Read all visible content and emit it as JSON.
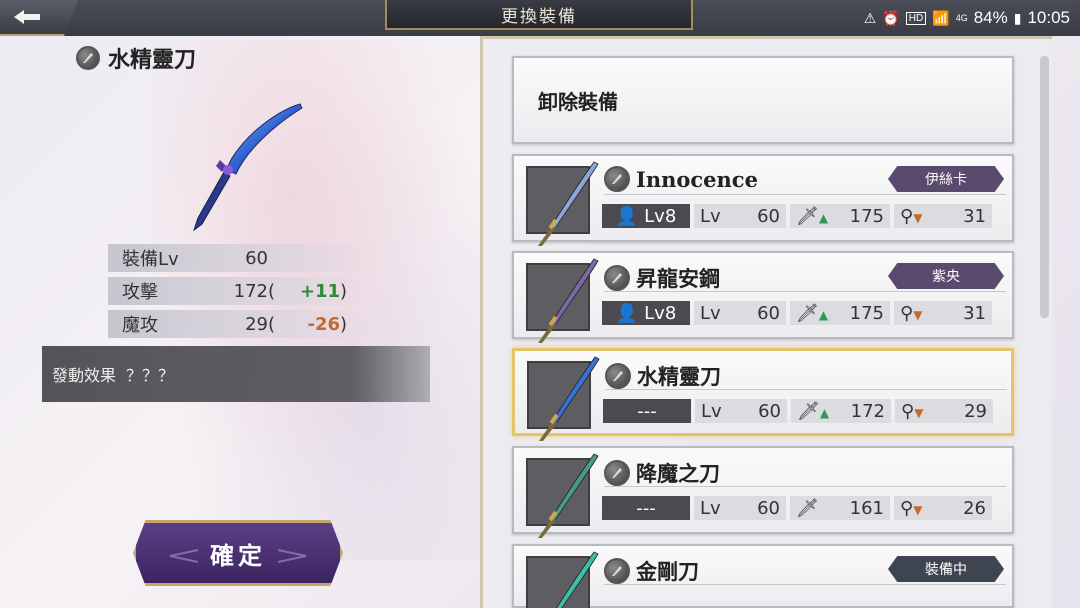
{
  "header": {
    "title": "更換裝備"
  },
  "status": {
    "battery": "84%",
    "time": "10:05",
    "hd": "HD",
    "network": "4G"
  },
  "detail": {
    "weapon_name": "水精靈刀",
    "stats": [
      {
        "label": "裝備Lv",
        "value": "60",
        "paren_open": "",
        "delta": "",
        "paren_close": "",
        "trend": ""
      },
      {
        "label": "攻擊",
        "value": "172",
        "paren_open": "(",
        "delta": "+11",
        "paren_close": ")",
        "trend": "up"
      },
      {
        "label": "魔攻",
        "value": "29",
        "paren_open": "(",
        "delta": "-26",
        "paren_close": ")",
        "trend": "down"
      }
    ],
    "effect_label": "發動效果",
    "effect_value": "？？？",
    "confirm_label": "確定"
  },
  "list": {
    "unequip_label": "卸除裝備",
    "items": [
      {
        "name": "Innocence",
        "tag": "伊絲卡",
        "char_lv": "Lv8",
        "lv_label": "Lv",
        "lv": "60",
        "atk": "175",
        "mag": "31",
        "atk_icon": "sword-icon",
        "mag_icon": "wand-icon",
        "trend": "mixed",
        "blade_color": "#8aa9d8"
      },
      {
        "name": "昇龍安鋼",
        "tag": "紫央",
        "char_lv": "Lv8",
        "lv_label": "Lv",
        "lv": "60",
        "atk": "175",
        "mag": "31",
        "atk_icon": "sword-icon",
        "mag_icon": "wand-icon",
        "trend": "mixed",
        "blade_color": "#7a68a8"
      },
      {
        "name": "水精靈刀",
        "tag": "",
        "char_lv": "---",
        "lv_label": "Lv",
        "lv": "60",
        "atk": "172",
        "mag": "29",
        "atk_icon": "sword-icon",
        "mag_icon": "wand-icon",
        "trend": "mixed",
        "blade_color": "#3a6fd8"
      },
      {
        "name": "降魔之刀",
        "tag": "",
        "char_lv": "---",
        "lv_label": "Lv",
        "lv": "60",
        "atk": "161",
        "mag": "26",
        "atk_icon": "sword-icon",
        "mag_icon": "wand-icon",
        "trend": "none",
        "blade_color": "#4a9a8a"
      },
      {
        "name": "金剛刀",
        "tag": "裝備中",
        "char_lv": "",
        "lv_label": "",
        "lv": "",
        "atk": "",
        "mag": "",
        "atk_icon": "sword-icon",
        "mag_icon": "wand-icon",
        "trend": "none",
        "blade_color": "#3ac0a8"
      }
    ]
  }
}
